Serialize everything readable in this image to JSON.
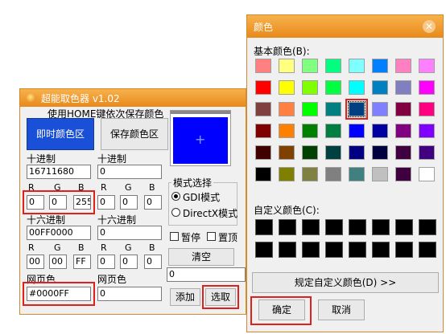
{
  "picker": {
    "title": "超能取色器 v1.02",
    "hint": "使用HOME键依次保存颜色",
    "realtime_btn": "即时颜色区",
    "saved_btn": "保存颜色区",
    "preview_color": "#0000ff",
    "left": {
      "dec_label": "十进制",
      "dec_value": "16711680",
      "r_label": "R",
      "g_label": "G",
      "b_label": "B",
      "r": "0",
      "g": "0",
      "b": "255",
      "hex_label": "十六进制",
      "hex_value": "00FF0000",
      "r2": "00",
      "g2": "00",
      "b2": "FF",
      "web_label": "网页色",
      "web_value": "#0000FF"
    },
    "right": {
      "dec_label": "十进制",
      "dec_value": "0",
      "r_label": "R",
      "g_label": "G",
      "b_label": "B",
      "r": "0",
      "g": "0",
      "b": "0",
      "hex_label": "十六进制",
      "hex_value": "0",
      "r2": "0",
      "g2": "0",
      "b2": "0",
      "web_label": "网页色",
      "web_value": "0"
    },
    "mode_group_label": "模式选择",
    "mode_gdi": "GDI模式",
    "mode_directx": "DirectX模式",
    "pause_label": "暂停",
    "topmost_label": "置顶",
    "clear_btn": "清空",
    "side_value": "0",
    "add_btn": "添加",
    "pick_btn": "选取"
  },
  "dialog": {
    "title": "颜色",
    "close_icon": "close-icon",
    "basic_label": "基本颜色(B):",
    "basic_colors": [
      [
        "#ff8080",
        "#ffff80",
        "#80ff80",
        "#00ff80",
        "#80ffff",
        "#0080ff",
        "#ff80c0",
        "#ff80ff"
      ],
      [
        "#ff0000",
        "#ffff00",
        "#80ff00",
        "#00ff40",
        "#00ffff",
        "#0080c0",
        "#8080c0",
        "#ff00ff"
      ],
      [
        "#804040",
        "#ff8040",
        "#00ff00",
        "#008080",
        "#004080",
        "#8080ff",
        "#800040",
        "#ff0080"
      ],
      [
        "#800000",
        "#ff8000",
        "#008000",
        "#008040",
        "#0000ff",
        "#0000a0",
        "#800080",
        "#8000ff"
      ],
      [
        "#400000",
        "#804000",
        "#004000",
        "#004040",
        "#000080",
        "#000040",
        "#400040",
        "#400080"
      ],
      [
        "#000000",
        "#808000",
        "#808040",
        "#808080",
        "#408080",
        "#c0c0c0",
        "#400040",
        "#ffffff"
      ]
    ],
    "selected_index": [
      2,
      4
    ],
    "custom_label": "自定义颜色(C):",
    "custom_color": "#000000",
    "define_btn": "规定自定义颜色(D) >>",
    "ok_btn": "确定",
    "cancel_btn": "取消"
  }
}
